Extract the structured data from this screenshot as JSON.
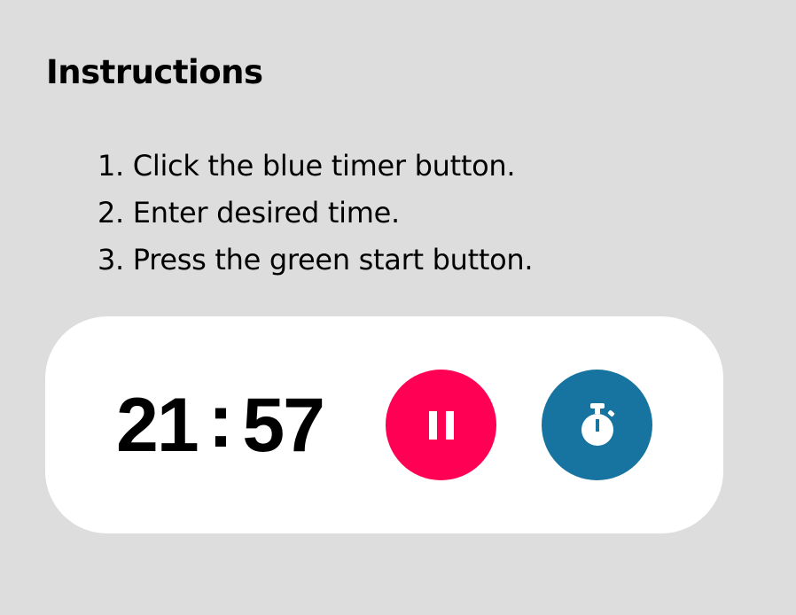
{
  "instructions": {
    "title": "Instructions",
    "steps": [
      "1. Click the blue timer button.",
      "2. Enter desired time.",
      "3. Press the green start button."
    ]
  },
  "timer": {
    "minutes": "21",
    "separator": ":",
    "seconds": "57"
  },
  "buttons": {
    "pause": {
      "icon": "pause-icon",
      "color": "#ff0055"
    },
    "timer": {
      "icon": "stopwatch-icon",
      "color": "#17739f"
    }
  },
  "colors": {
    "background": "#dddddd",
    "card": "#ffffff",
    "text": "#000000"
  }
}
